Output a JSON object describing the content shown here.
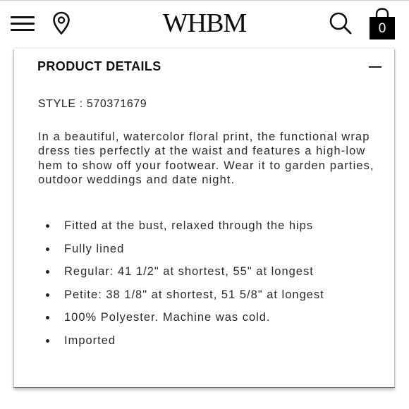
{
  "header": {
    "logo_text": "WHBM",
    "bag_count": "0",
    "icons": [
      "menu-icon",
      "location-pin-icon",
      "search-icon",
      "shopping-bag-icon"
    ]
  },
  "product_details": {
    "title": "PRODUCT DETAILS",
    "style_line": "STYLE : 570371679",
    "description": "In a beautiful, watercolor floral print, the functional wrap dress ties perfectly at the waist and features a high-low hem to show off your footwear. Wear it to garden parties, outdoor weddings and date night.",
    "bullets": [
      "Fitted at the bust, relaxed through the hips",
      "Fully lined",
      "Regular: 41 1/2\" at shortest, 55\" at longest",
      "Petite: 38 1/8\" at shortest, 51 5/8\" at longest",
      "100% Polyester. Machine was cold.",
      "Imported"
    ]
  },
  "colors": {
    "text": "#1a1a1a",
    "bag": "#000000",
    "border": "#bdbdbd"
  }
}
